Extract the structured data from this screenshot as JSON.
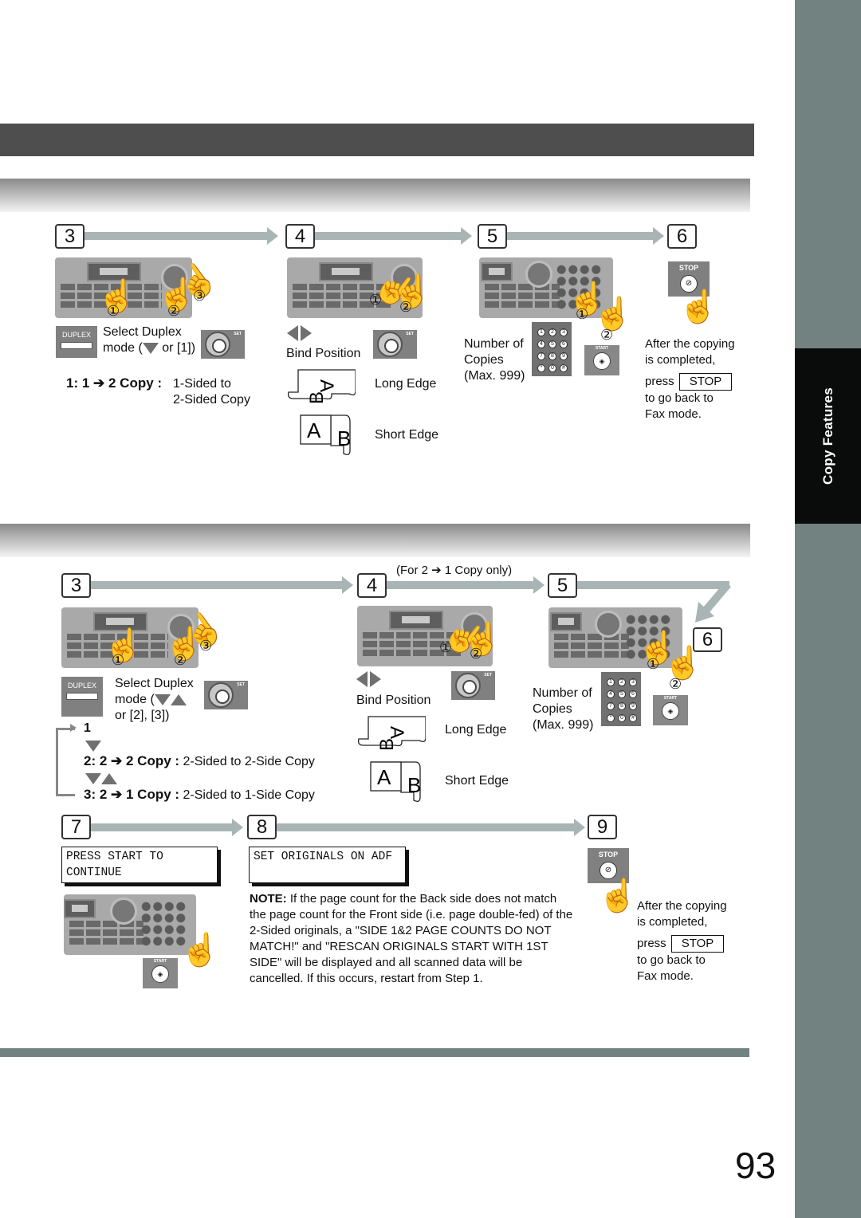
{
  "side_tab": {
    "label": "Copy Features"
  },
  "page_number": "93",
  "section1": {
    "steps": [
      {
        "num": "3"
      },
      {
        "num": "4"
      },
      {
        "num": "5"
      },
      {
        "num": "6"
      }
    ],
    "step3": {
      "duplex_key": "DUPLEX",
      "instruction_line1": "Select Duplex",
      "instruction_line2_pre": "mode (",
      "instruction_line2_post": " or [1])",
      "mode_code": "1: 1 ➔ 2 Copy :",
      "mode_desc_line1": "1-Sided to",
      "mode_desc_line2": "2-Sided Copy",
      "set_label": "SET"
    },
    "step4": {
      "bind_label": "Bind Position",
      "long_edge": "Long Edge",
      "short_edge": "Short Edge",
      "set_label": "SET"
    },
    "step5": {
      "line1": "Number of",
      "line2": "Copies",
      "line3": "(Max. 999)",
      "start_key": "START"
    },
    "step6": {
      "stop_key": "STOP",
      "line1": "After the copying",
      "line2": "is completed,",
      "press": "press",
      "stop_label": "STOP",
      "line4": "to go back to",
      "line5": "Fax mode."
    }
  },
  "section2": {
    "steps": [
      {
        "num": "3"
      },
      {
        "num": "4"
      },
      {
        "num": "5"
      },
      {
        "num": "6"
      },
      {
        "num": "7"
      },
      {
        "num": "8"
      },
      {
        "num": "9"
      }
    ],
    "step4_note": "(For 2 ➔ 1 Copy only)",
    "step3": {
      "duplex_key": "DUPLEX",
      "instruction_line1": "Select Duplex",
      "instruction_line2_pre": "mode (",
      "instruction_line3": "or [2], [3])",
      "cycle_1": "1",
      "mode2_code": "2: 2 ➔ 2 Copy :",
      "mode2_desc": "2-Sided to 2-Side Copy",
      "mode3_code": "3: 2 ➔ 1 Copy :",
      "mode3_desc": "2-Sided to 1-Side Copy",
      "set_label": "SET"
    },
    "step4": {
      "bind_label": "Bind Position",
      "long_edge": "Long Edge",
      "short_edge": "Short Edge",
      "set_label": "SET"
    },
    "step5": {
      "line1": "Number of",
      "line2": "Copies",
      "line3": "(Max. 999)",
      "start_key": "START"
    },
    "step7": {
      "lcd_line1": "PRESS START TO",
      "lcd_line2": "CONTINUE",
      "start_key": "START"
    },
    "step8": {
      "lcd_line1": "SET ORIGINALS ON ADF",
      "note_label": "NOTE:",
      "note_text": " If the page count for the Back side does not match the page count for the Front side (i.e. page double-fed) of the 2-Sided originals, a \"SIDE 1&2 PAGE COUNTS DO NOT MATCH!\" and \"RESCAN ORIGINALS START WITH 1ST SIDE\"  will be displayed and all scanned data will be cancelled. If this occurs, restart from Step 1."
    },
    "step9": {
      "stop_key": "STOP",
      "line1": "After the copying",
      "line2": "is completed,",
      "press": "press",
      "stop_label": "STOP",
      "line4": "to go back to",
      "line5": "Fax mode."
    }
  },
  "keypad_digits": [
    "1",
    "2",
    "3",
    "4",
    "5",
    "6",
    "7",
    "8",
    "9",
    "*",
    "0",
    "#"
  ],
  "callouts": {
    "one": "①",
    "two": "②",
    "three": "③"
  },
  "edge_letters": {
    "a": "A",
    "b": "B"
  },
  "colors": {
    "accent_band": "#728281",
    "title_bar": "#4e4e4e",
    "flow_arrow": "#a9b5b5",
    "tab_black": "#0a0c0b"
  }
}
